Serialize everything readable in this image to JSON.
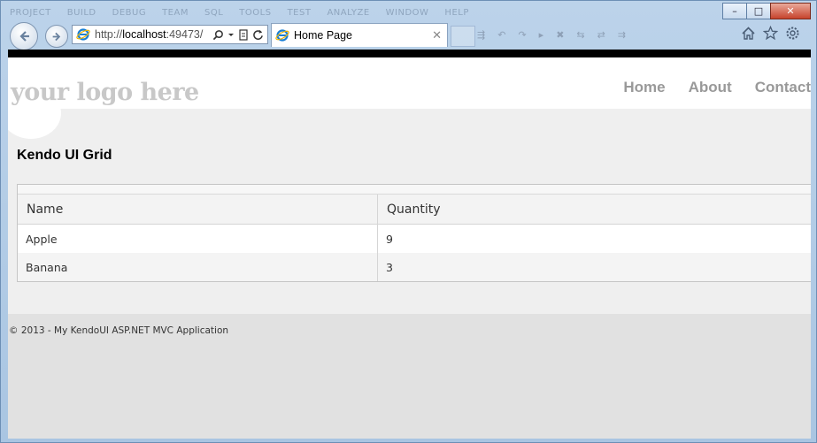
{
  "browser": {
    "menu": [
      "PROJECT",
      "BUILD",
      "DEBUG",
      "TEAM",
      "SQL",
      "TOOLS",
      "TEST",
      "ANALYZE",
      "WINDOW",
      "HELP"
    ],
    "address": {
      "prefix": "http://",
      "host": "localhost",
      "port": ":49473/"
    },
    "tab_title": "Home Page",
    "controls": {
      "minimize": "–",
      "maximize": "□",
      "close": "✕"
    },
    "nav_icons": [
      "back-icon",
      "forward-icon"
    ],
    "icons": [
      "home-icon",
      "favorites-star-icon",
      "tools-gear-icon"
    ]
  },
  "site": {
    "logo": "your logo here",
    "menu": [
      "Home",
      "About",
      "Contact"
    ]
  },
  "page": {
    "heading": "Kendo UI Grid",
    "grid": {
      "columns": [
        "Name",
        "Quantity"
      ],
      "rows": [
        [
          "Apple",
          "9"
        ],
        [
          "Banana",
          "3"
        ]
      ]
    }
  },
  "footer": {
    "text": "© 2013 - My KendoUI ASP.NET MVC Application"
  }
}
